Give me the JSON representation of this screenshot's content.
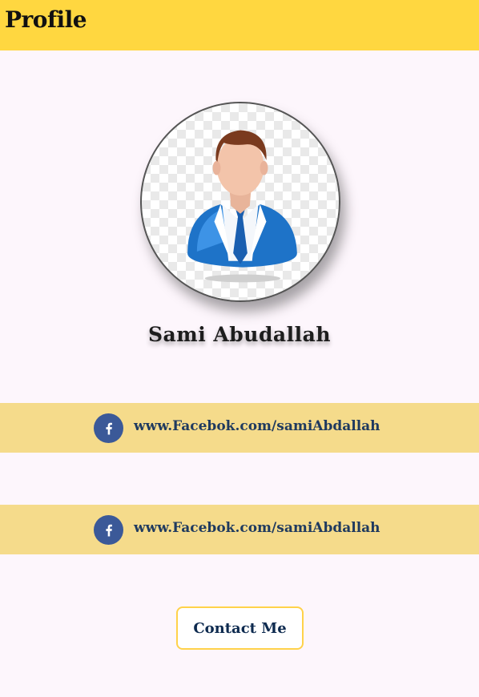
{
  "header": {
    "title": "Profile",
    "bg_color": "#ffd740"
  },
  "profile": {
    "name": "Sami Abudallah",
    "avatar_icon": "businessman-avatar-icon"
  },
  "links": [
    {
      "icon": "facebook-icon",
      "text": "www.Facebok.com/samiAbdallah",
      "color": "#3b5998"
    },
    {
      "icon": "facebook-icon",
      "text": "www.Facebok.com/samiAbdallah",
      "color": "#3b5998"
    }
  ],
  "contact_button": {
    "label": "Contact Me",
    "border_color": "#ffd24a"
  }
}
